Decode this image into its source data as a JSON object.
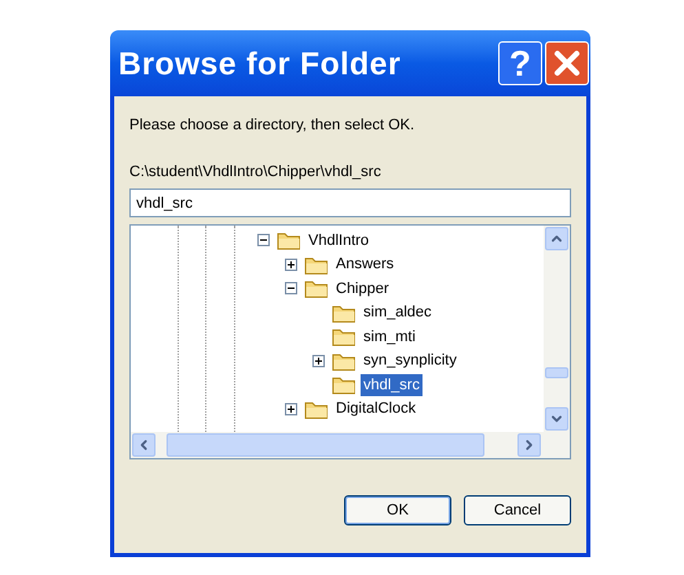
{
  "window": {
    "title": "Browse for Folder",
    "help_button": "?"
  },
  "message": "Please choose a directory, then select OK.",
  "path": "C:\\student\\VhdlIntro\\Chipper\\vhdl_src",
  "folder_field": {
    "value": "vhdl_src"
  },
  "tree": {
    "items": [
      {
        "label": "VhdlIntro",
        "expanded": true,
        "selected": false,
        "children": [
          {
            "label": "Answers",
            "expanded": false,
            "has_children": true,
            "selected": false
          },
          {
            "label": "Chipper",
            "expanded": true,
            "selected": false,
            "children": [
              {
                "label": "sim_aldec",
                "selected": false
              },
              {
                "label": "sim_mti",
                "selected": false
              },
              {
                "label": "syn_synplicity",
                "expanded": false,
                "has_children": true,
                "selected": false
              },
              {
                "label": "vhdl_src",
                "selected": true
              }
            ]
          },
          {
            "label": "DigitalClock",
            "expanded": false,
            "has_children": true,
            "selected": false
          }
        ]
      }
    ]
  },
  "buttons": [
    {
      "label": "OK",
      "default": true
    },
    {
      "label": "Cancel",
      "default": false
    }
  ]
}
